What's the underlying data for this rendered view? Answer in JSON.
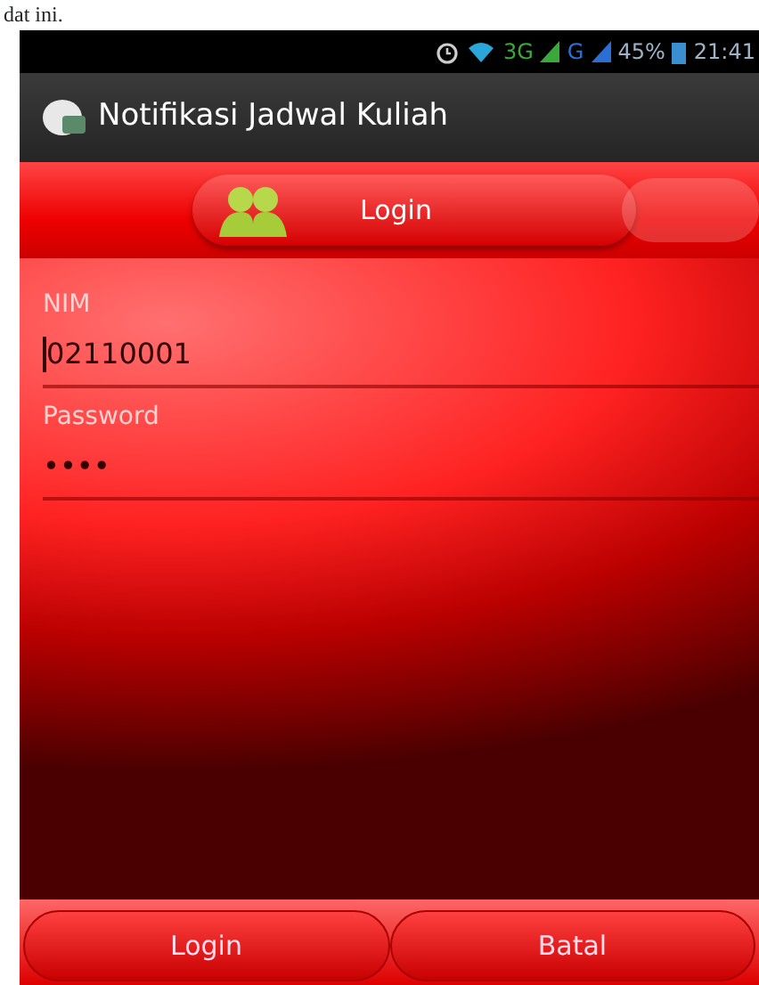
{
  "document_text": "dat ini.",
  "status_bar": {
    "network_1": "3G",
    "network_2": "G",
    "battery": "45%",
    "time": "21:41"
  },
  "app_bar": {
    "title": "Notifikasi Jadwal Kuliah"
  },
  "tabs": [
    {
      "label": "Login",
      "selected": true
    }
  ],
  "fields": [
    {
      "label": "NIM",
      "value": "02110001",
      "focused": true
    },
    {
      "label": "Password",
      "value": "••••",
      "focused": false
    }
  ],
  "buttons": [
    "Login",
    "Batal"
  ]
}
